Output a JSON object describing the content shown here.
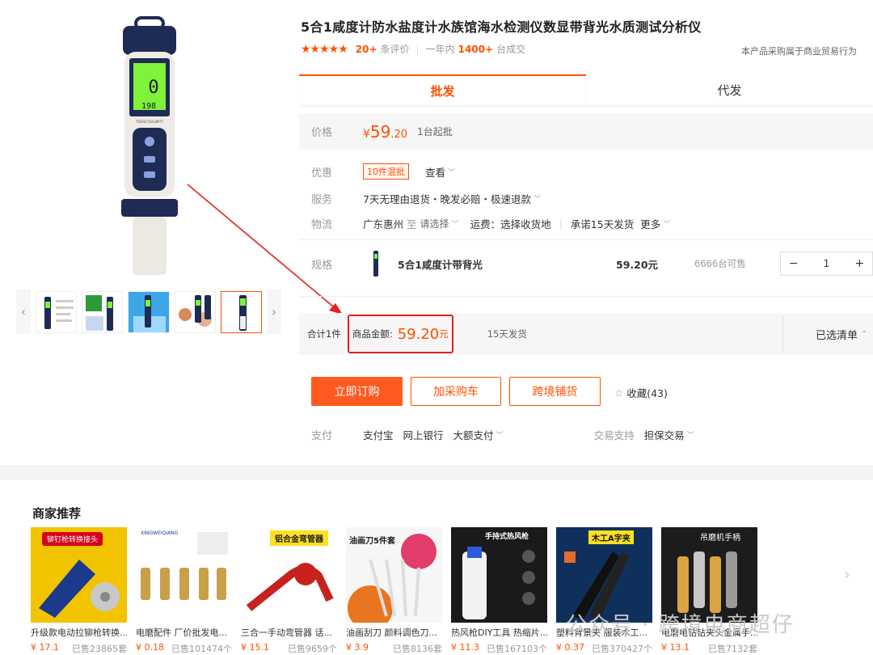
{
  "product": {
    "title": "5合1咸度计防水盐度计水族馆海水检测仪数显带背光水质测试分析仪",
    "stars": "★★★★★",
    "review_count": "20+",
    "review_label": "条评价",
    "year_label": "一年内",
    "deal_count": "1400+",
    "deal_label": "台成交",
    "trade_note": "本产品采购属于商业贸易行为",
    "device_screen_top": "0",
    "device_screen_bottom": "198",
    "device_brand": "TDS/EC/SALINITY"
  },
  "tabs": [
    {
      "label": "批发",
      "active": true
    },
    {
      "label": "代发",
      "active": false
    }
  ],
  "price": {
    "label": "价格",
    "symbol": "¥",
    "integer": "59",
    "decimal": ".20",
    "moq": "1台起批"
  },
  "offer": {
    "label": "优惠",
    "chip": "10件混批",
    "view": "查看"
  },
  "service": {
    "label": "服务",
    "text": "7天无理由退货・晚发必赔・极速退款"
  },
  "logistics": {
    "label": "物流",
    "origin": "广东惠州",
    "to": "至",
    "choose": "请选择",
    "freight": "运费：选择收货地",
    "promise": "承诺15天发货",
    "more": "更多"
  },
  "spec": {
    "label": "规格",
    "name": "5合1咸度计带背光",
    "price": "59.20元",
    "stock": "6666台可售",
    "minus": "−",
    "qty": "1",
    "plus": "+"
  },
  "summary": {
    "count": "合计1件",
    "amount_label": "商品金额:",
    "amount": "59.20",
    "unit": "元",
    "ship": "15天发货",
    "cart_list": "已选清单",
    "caret": "⌃"
  },
  "actions": {
    "buy": "立即订购",
    "cart": "加采购车",
    "cross": "跨境铺货",
    "fav": "收藏(43)"
  },
  "payment": {
    "label": "支付",
    "methods": [
      "支付宝",
      "网上银行",
      "大额支付"
    ],
    "support_label": "交易支持",
    "support": "担保交易"
  },
  "recommend": {
    "title": "商家推荐",
    "items": [
      {
        "name": "升级款电动拉铆枪转换...",
        "price": "¥ 17.1",
        "sold": "已售23865套",
        "banner": "铆钉枪转换接头",
        "color": "#f2c400"
      },
      {
        "name": "电磨配件 厂价批发电...",
        "price": "¥ 0.18",
        "sold": "已售101474个",
        "banner": "XINGWEIQIANG",
        "color": "#ffffff"
      },
      {
        "name": "三合一手动弯管器 话...",
        "price": "¥ 15.1",
        "sold": "已售9659个",
        "banner": "铝合金弯管器",
        "color": "#ffe020"
      },
      {
        "name": "油画刮刀 颜料调色刀...",
        "price": "¥ 3.9",
        "sold": "已售8136套",
        "banner": "油画刀5件套",
        "color": "#f6f6f6"
      },
      {
        "name": "热风枪DIY工具 热缩片...",
        "price": "¥ 11.3",
        "sold": "已售167103个",
        "banner": "手持式热风枪",
        "color": "#1a1a1a"
      },
      {
        "name": "塑料背景夹 服装木工...",
        "price": "¥ 0.37",
        "sold": "已售370427个",
        "banner": "木工A字夹",
        "color": "#10305c"
      },
      {
        "name": "电磨电钻钻夹头金属手...",
        "price": "¥ 13.1",
        "sold": "已售7132套",
        "banner": "吊磨机手柄",
        "color": "#1c1c1c"
      }
    ]
  },
  "watermark": "公众号 · 跨境电商超仔"
}
